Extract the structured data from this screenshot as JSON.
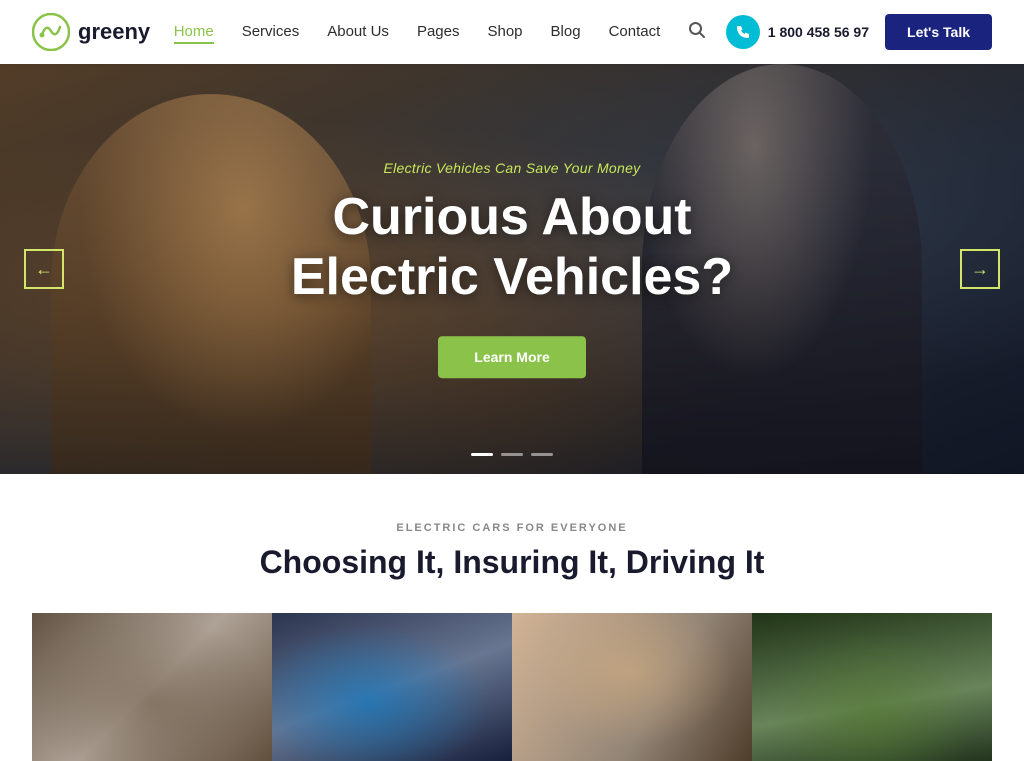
{
  "logo": {
    "text": "greeny",
    "icon_label": "greeny-logo-icon"
  },
  "nav": {
    "links": [
      {
        "label": "Home",
        "active": true
      },
      {
        "label": "Services",
        "active": false
      },
      {
        "label": "About Us",
        "active": false
      },
      {
        "label": "Pages",
        "active": false
      },
      {
        "label": "Shop",
        "active": false
      },
      {
        "label": "Blog",
        "active": false
      },
      {
        "label": "Contact",
        "active": false
      }
    ],
    "phone": "1 800 458 56 97",
    "lets_talk": "Let's Talk"
  },
  "hero": {
    "subtitle": "Electric Vehicles Can Save Your Money",
    "title_line1": "Curious About",
    "title_line2": "Electric Vehicles?",
    "cta_label": "Learn More",
    "arrow_left": "←",
    "arrow_right": "→",
    "dots": [
      {
        "active": true
      },
      {
        "active": false
      },
      {
        "active": false
      }
    ]
  },
  "section": {
    "label": "ELECTRIC CARS FOR EVERYONE",
    "title": "Choosing It, Insuring It, Driving It",
    "cards": [
      {
        "id": 1,
        "alt": "Electric car exterior"
      },
      {
        "id": 2,
        "alt": "EV charging port"
      },
      {
        "id": 3,
        "alt": "People in car"
      },
      {
        "id": 4,
        "alt": "Green leaf"
      }
    ]
  },
  "colors": {
    "accent_green": "#8bc34a",
    "accent_lime": "#c8e65b",
    "navy": "#1a237e",
    "dark": "#1a1a2e",
    "teal": "#00bcd4"
  }
}
